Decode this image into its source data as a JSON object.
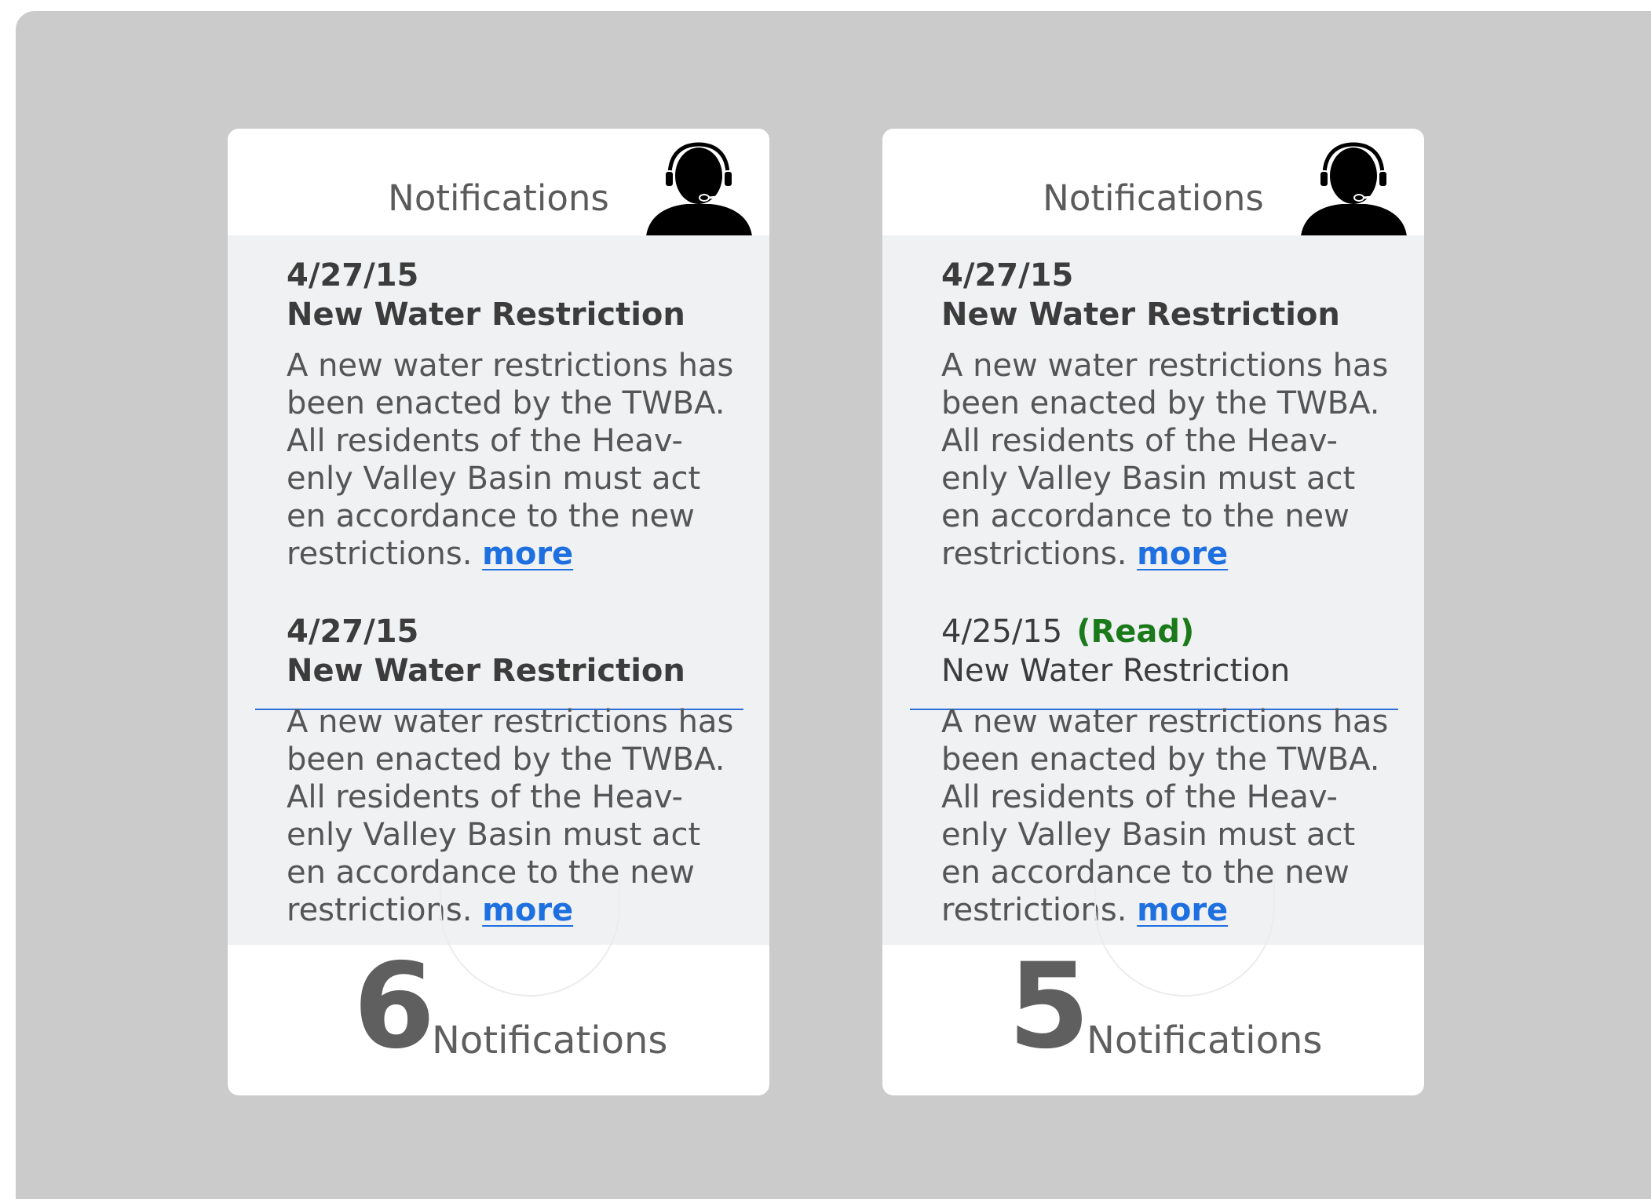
{
  "cards": [
    {
      "title": "Notifications",
      "avatar_icon": "support-agent-headset-icon",
      "notifications": [
        {
          "date": "4/27/15",
          "title": "New Water Restriction",
          "body": "A new water restrictions has been enacted by the TWBA. All residents of the Heav-enly Valley Basin must act en accordance to the new restrictions.",
          "more_label": "more",
          "unread": true
        },
        {
          "date": "4/27/15",
          "title": "New Water Restriction",
          "body": "A new water restrictions has been enacted by the TWBA. All residents of the Heav-enly Valley Basin must act en accordance to the new restrictions.",
          "more_label": "more",
          "unread": true
        }
      ],
      "count": "6",
      "count_label": "Notifications"
    },
    {
      "title": "Notifications",
      "avatar_icon": "support-agent-headset-icon",
      "notifications": [
        {
          "date": "4/27/15",
          "title": "New Water Restriction",
          "body": "A new water restrictions has been enacted by the TWBA. All residents of the Heav-enly Valley Basin must act en accordance to the new restrictions.",
          "more_label": "more",
          "unread": true
        },
        {
          "date": "4/25/15",
          "read_label": "(Read)",
          "title": "New Water Restriction",
          "body": "A new water restrictions has been enacted by the TWBA. All residents of the Heav-enly Valley Basin must act en accordance to the new restrictions.",
          "more_label": "more",
          "unread": false
        }
      ],
      "count": "5",
      "count_label": "Notifications"
    }
  ],
  "colors": {
    "background": "#cbcbcb",
    "card": "#ffffff",
    "card_body": "#f0f1f3",
    "link": "#1e6fe0",
    "divider": "#2f6fd9",
    "read": "#1a7a1a"
  }
}
